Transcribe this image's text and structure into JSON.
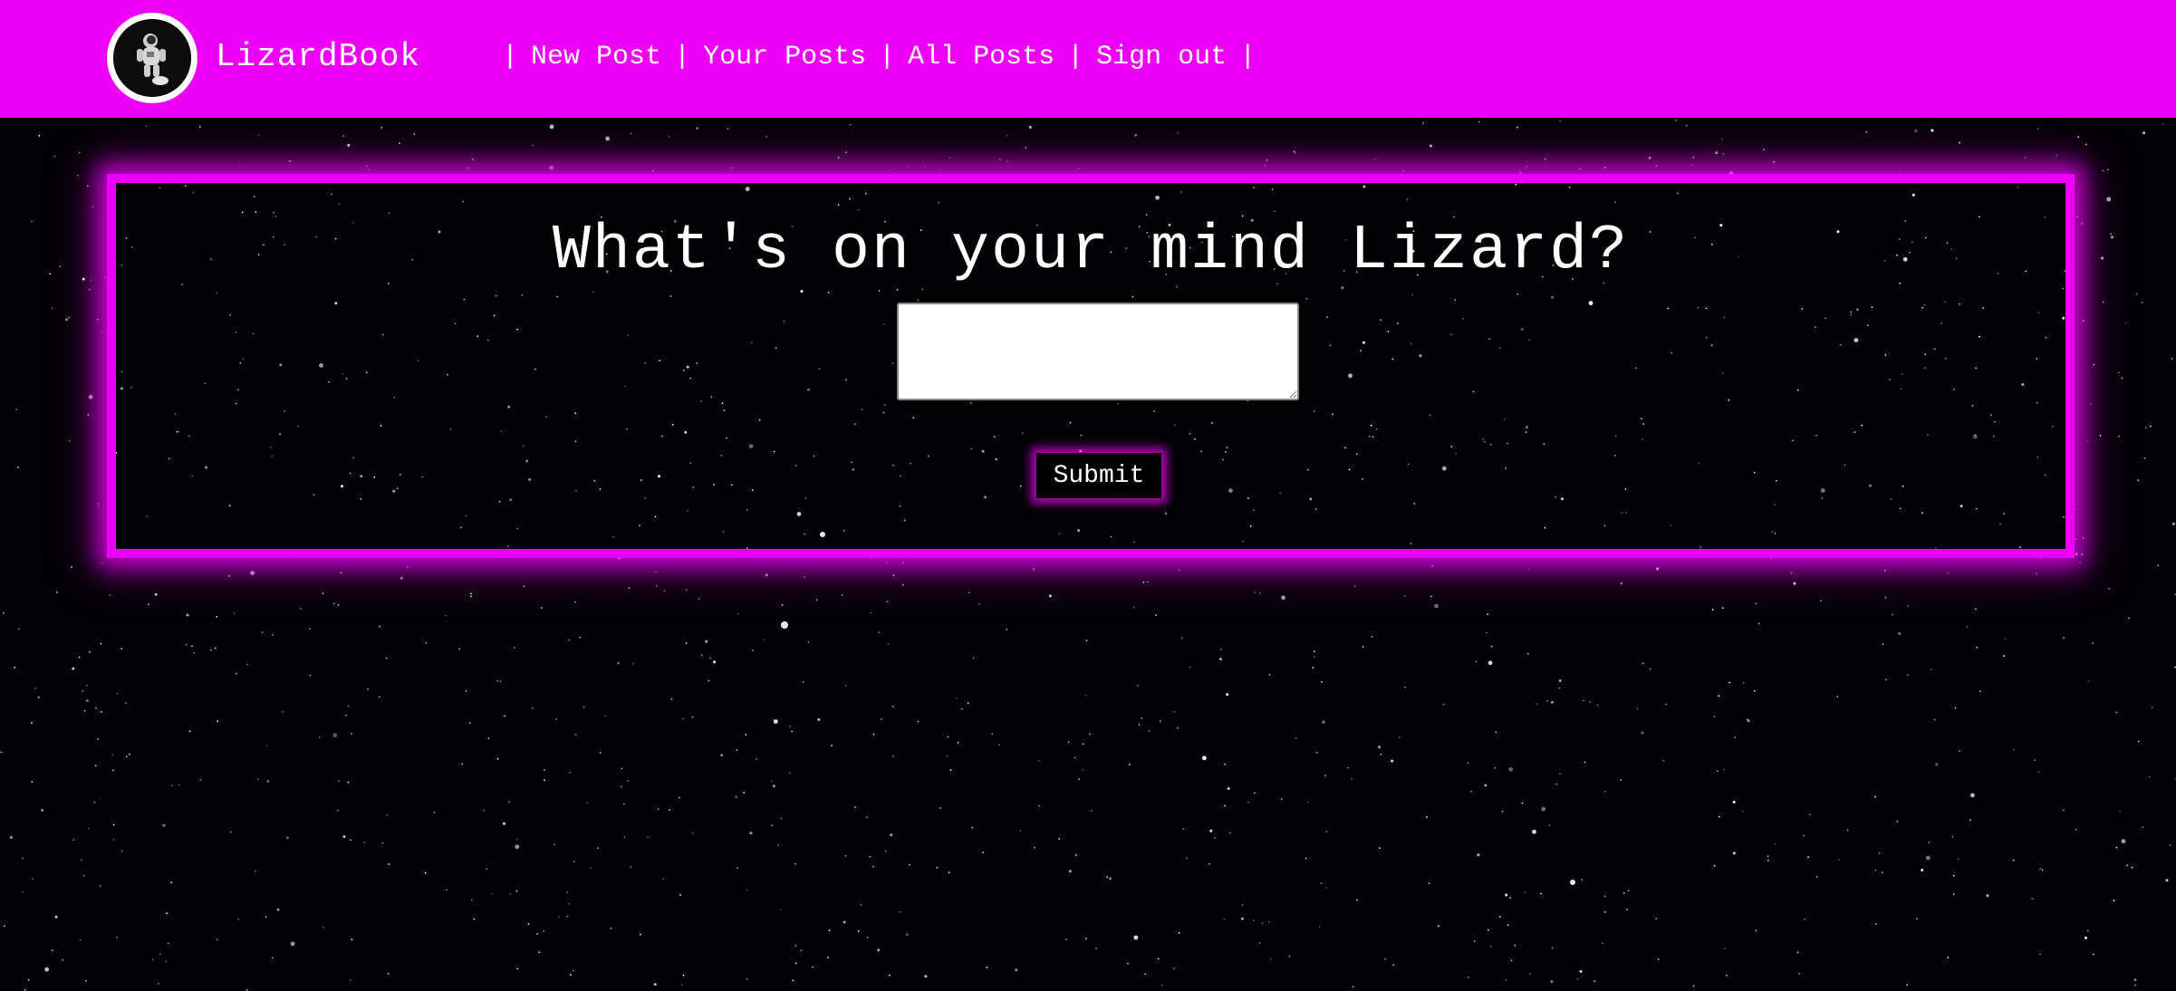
{
  "app": {
    "brand": "LizardBook",
    "avatar_icon": "astronaut-icon"
  },
  "nav": {
    "separator": "|",
    "links": [
      {
        "label": "New Post"
      },
      {
        "label": "Your Posts"
      },
      {
        "label": "All Posts"
      },
      {
        "label": "Sign out"
      }
    ]
  },
  "composer": {
    "prompt": "What's on your mind Lizard?",
    "textarea_value": "",
    "submit_label": "Submit"
  },
  "colors": {
    "accent": "#ee00f8",
    "background": "#000000",
    "text": "#ffffff"
  }
}
